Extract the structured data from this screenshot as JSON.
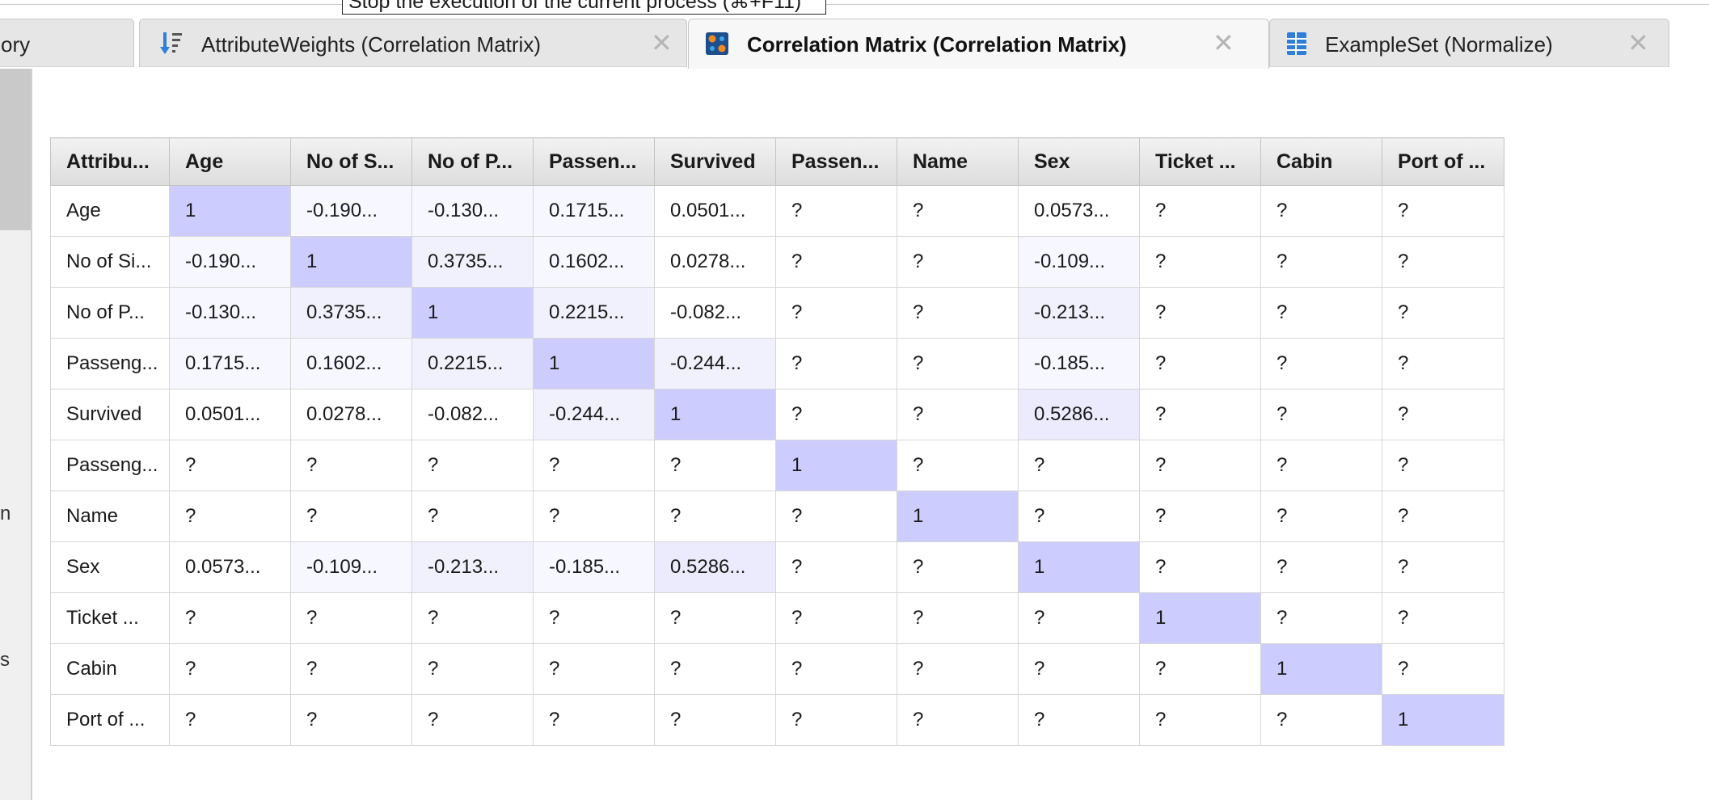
{
  "tooltip": "Stop the execution of the current process (⌘+F11)",
  "tabs": [
    {
      "label": "ory",
      "icon": "",
      "active": false
    },
    {
      "label": "AttributeWeights (Correlation Matrix)",
      "icon": "attribute-weights-icon",
      "active": false
    },
    {
      "label": "Correlation Matrix (Correlation Matrix)",
      "icon": "correlation-matrix-icon",
      "active": true
    },
    {
      "label": "ExampleSet (Normalize)",
      "icon": "exampleset-icon",
      "active": false
    }
  ],
  "close_glyph": "✕",
  "sidebar": {
    "fragments": [
      "n",
      "s"
    ]
  },
  "matrix": {
    "header": [
      "Attribu...",
      "Age",
      "No of S...",
      "No of P...",
      "Passen...",
      "Survived",
      "Passen...",
      "Name",
      "Sex",
      "Ticket ...",
      "Cabin",
      "Port of ..."
    ],
    "rows": [
      {
        "label": "Age",
        "cells": [
          "1",
          "-0.190...",
          "-0.130...",
          "0.1715...",
          "0.0501...",
          "?",
          "?",
          "0.0573...",
          "?",
          "?",
          "?"
        ]
      },
      {
        "label": "No of Si...",
        "cells": [
          "-0.190...",
          "1",
          "0.3735...",
          "0.1602...",
          "0.0278...",
          "?",
          "?",
          "-0.109...",
          "?",
          "?",
          "?"
        ]
      },
      {
        "label": "No of P...",
        "cells": [
          "-0.130...",
          "0.3735...",
          "1",
          "0.2215...",
          "-0.082...",
          "?",
          "?",
          "-0.213...",
          "?",
          "?",
          "?"
        ]
      },
      {
        "label": "Passeng...",
        "cells": [
          "0.1715...",
          "0.1602...",
          "0.2215...",
          "1",
          "-0.244...",
          "?",
          "?",
          "-0.185...",
          "?",
          "?",
          "?"
        ]
      },
      {
        "label": "Survived",
        "cells": [
          "0.0501...",
          "0.0278...",
          "-0.082...",
          "-0.244...",
          "1",
          "?",
          "?",
          "0.5286...",
          "?",
          "?",
          "?"
        ]
      },
      {
        "label": "Passeng...",
        "cells": [
          "?",
          "?",
          "?",
          "?",
          "?",
          "1",
          "?",
          "?",
          "?",
          "?",
          "?"
        ]
      },
      {
        "label": "Name",
        "cells": [
          "?",
          "?",
          "?",
          "?",
          "?",
          "?",
          "1",
          "?",
          "?",
          "?",
          "?"
        ]
      },
      {
        "label": "Sex",
        "cells": [
          "0.0573...",
          "-0.109...",
          "-0.213...",
          "-0.185...",
          "0.5286...",
          "?",
          "?",
          "1",
          "?",
          "?",
          "?"
        ]
      },
      {
        "label": "Ticket ...",
        "cells": [
          "?",
          "?",
          "?",
          "?",
          "?",
          "?",
          "?",
          "?",
          "1",
          "?",
          "?"
        ]
      },
      {
        "label": "Cabin",
        "cells": [
          "?",
          "?",
          "?",
          "?",
          "?",
          "?",
          "?",
          "?",
          "?",
          "1",
          "?"
        ]
      },
      {
        "label": "Port of ...",
        "cells": [
          "?",
          "?",
          "?",
          "?",
          "?",
          "?",
          "?",
          "?",
          "?",
          "?",
          "1"
        ]
      }
    ],
    "colors": {
      "diagonal": "#ccccff",
      "zero": "#ffffff",
      "weak": "#f7f7ff",
      "moderate": "#f1f1fe",
      "strong": "#ebebfd"
    }
  }
}
